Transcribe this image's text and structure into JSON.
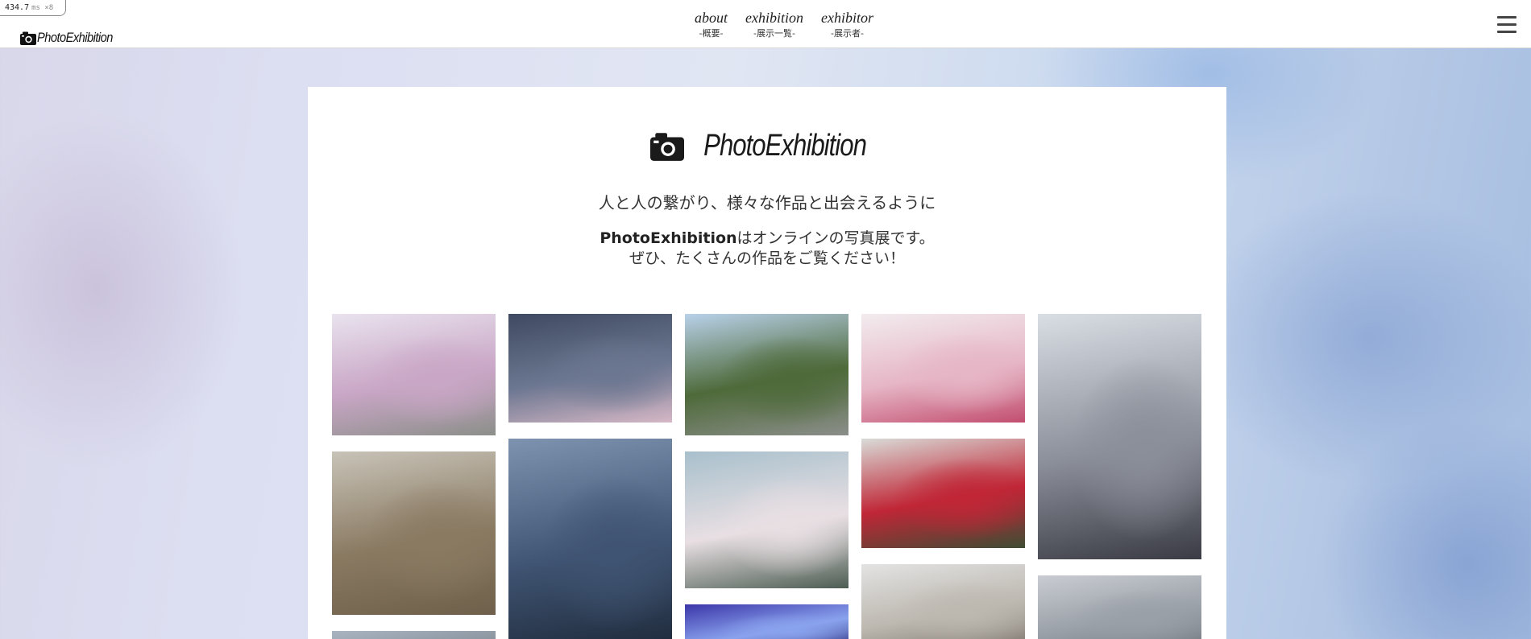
{
  "debug": {
    "value": "434.7",
    "unit": "ms ×8"
  },
  "header": {
    "logo_text": "PhotoExhibition",
    "nav": [
      {
        "en": "about",
        "jp": "-概要-"
      },
      {
        "en": "exhibition",
        "jp": "-展示一覧-"
      },
      {
        "en": "exhibitor",
        "jp": "-展示者-"
      }
    ]
  },
  "hero": {
    "logo_text": "PhotoExhibition",
    "tagline": "人と人の繋がり、様々な作品と出会えるように",
    "intro_brand": "PhotoExhibition",
    "intro_line1_rest": "はオンラインの写真展です。",
    "intro_line2": "ぜひ、たくさんの作品をご覧ください！"
  },
  "gallery": [
    {
      "subject": "cherry blossom river",
      "colors": [
        "#e9e3ee",
        "#c9a6c6",
        "#8c8f8a"
      ]
    },
    {
      "subject": "plum blossom branch",
      "colors": [
        "#3f4a62",
        "#6b7690",
        "#d6b8c6"
      ]
    },
    {
      "subject": "country road",
      "colors": [
        "#b9d1ea",
        "#4e6a3a",
        "#8b8e8a"
      ]
    },
    {
      "subject": "pink blossoms",
      "colors": [
        "#f2ecef",
        "#e6b6c6",
        "#c24d6f"
      ]
    },
    {
      "subject": "kitten by window",
      "colors": [
        "#d9dde4",
        "#8b8f99",
        "#3a3b44"
      ]
    },
    {
      "subject": "beach sand",
      "colors": [
        "#c8c3b8",
        "#8a7a62",
        "#6f604b"
      ]
    },
    {
      "subject": "hand and mirror",
      "colors": [
        "#7d93b0",
        "#3f5472",
        "#1f2a3b"
      ]
    },
    {
      "subject": "white blossoms",
      "colors": [
        "#a8c0cc",
        "#e8dfe3",
        "#4c5d52"
      ]
    },
    {
      "subject": "red camellia",
      "colors": [
        "#d9dcd8",
        "#c02636",
        "#3f4d34"
      ]
    },
    {
      "subject": "kitten in box",
      "colors": [
        "#e3e3e3",
        "#bdb8b0",
        "#7a746c"
      ]
    },
    {
      "subject": "kitten grey",
      "colors": [
        "#c9ccd2",
        "#9aa0a8",
        "#6f747b"
      ]
    },
    {
      "subject": "landscape",
      "colors": [
        "#a9b4c0",
        "#8f99a4",
        "#6a727b"
      ]
    },
    {
      "subject": "light beams",
      "colors": [
        "#3b36a8",
        "#8aa3ee",
        "#14115e"
      ]
    }
  ]
}
